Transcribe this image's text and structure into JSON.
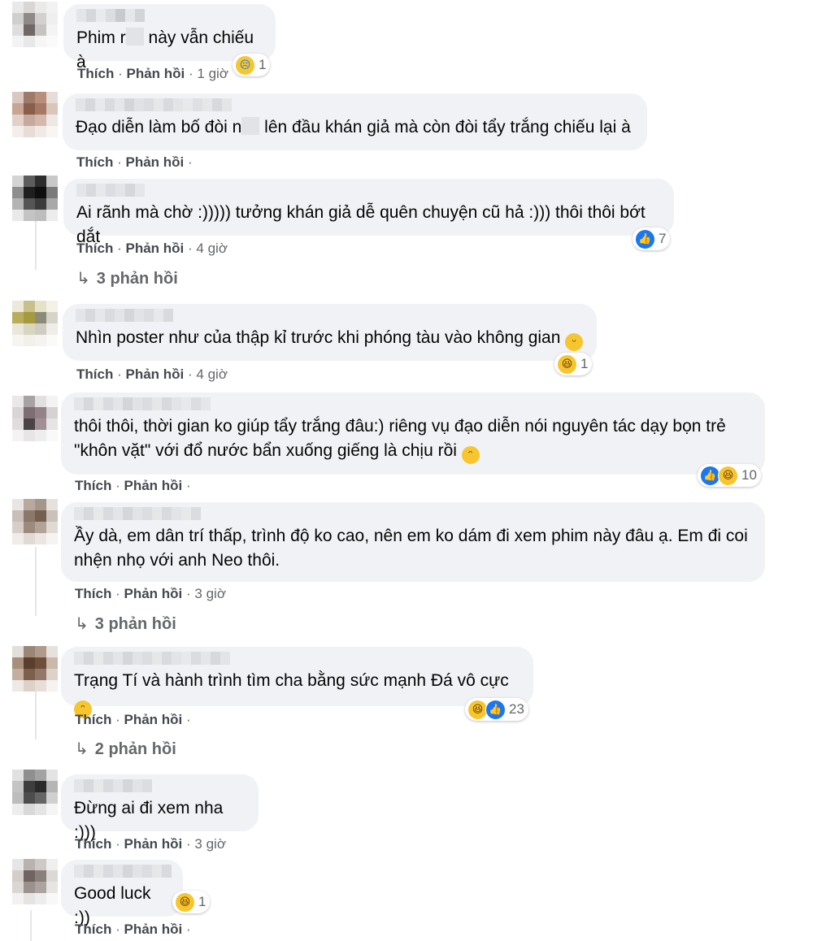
{
  "labels": {
    "like": "Thích",
    "reply": "Phản hồi",
    "sep": "·"
  },
  "comments": [
    {
      "text_pre": "Phim r",
      "text_post": " này vẫn chiếu à",
      "time": "1 giờ",
      "reaction_count": "1",
      "reactions": [
        "sad"
      ]
    },
    {
      "text_pre": "Đạo diễn làm bố đòi n",
      "text_post": " lên đầu khán giả mà còn đòi tẩy trắng chiếu lại à",
      "time": "",
      "reaction_count": "",
      "reactions": []
    },
    {
      "text": "Ai rãnh mà chờ :))))) tưởng khán giả dễ quên chuyện cũ hả :))) thôi thôi bớt dắt",
      "time": "4 giờ",
      "reaction_count": "7",
      "reactions": [
        "like"
      ],
      "replies": "3 phản hồi"
    },
    {
      "text": "Nhìn poster như của thập kỉ trước khi phóng tàu vào không gian",
      "emoji": "smile-emoji",
      "time": "4 giờ",
      "reaction_count": "1",
      "reactions": [
        "haha"
      ]
    },
    {
      "text": "thôi thôi, thời gian ko giúp tẩy trắng đâu:) riêng vụ đạo diễn nói nguyên tác dạy bọn trẻ\n\"khôn vặt\" với đổ nước bẩn xuống giếng là chịu rồi",
      "emoji": "grin-emoji",
      "time": "",
      "reaction_count": "10",
      "reactions": [
        "like",
        "haha"
      ]
    },
    {
      "text": "Ầy dà, em dân trí thấp, trình độ ko cao, nên em ko dám đi xem phim này đâu ạ. Em đi coi\nnhện nhọ với anh Neo thôi.",
      "time": "3 giờ",
      "reaction_count": "",
      "reactions": [],
      "replies": "3 phản hồi"
    },
    {
      "text": "Trạng Tí và hành trình tìm cha bằng sức mạnh Đá vô cực",
      "emoji": "rofl-emoji",
      "time": "",
      "reaction_count": "23",
      "reactions": [
        "haha",
        "like"
      ],
      "replies": "2 phản hồi"
    },
    {
      "text": "Đừng ai đi xem nha :)))",
      "time": "3 giờ",
      "reaction_count": "",
      "reactions": []
    },
    {
      "text": "Good luck :))",
      "time": "",
      "reaction_count": "1",
      "reactions": [
        "haha"
      ]
    }
  ]
}
